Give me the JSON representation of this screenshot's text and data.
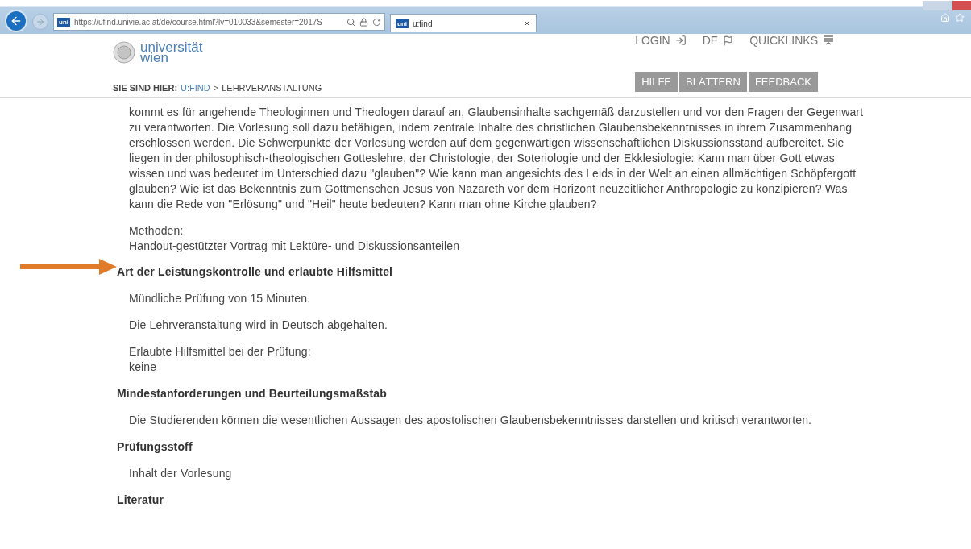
{
  "browser": {
    "url": "https://ufind.univie.ac.at/de/course.html?lv=010033&semester=2017S",
    "tab_title": "u:find",
    "address_badge": "uni",
    "tab_badge": "uni"
  },
  "header": {
    "logo_lines": [
      "universität",
      "wien"
    ],
    "nav": [
      {
        "kind": "login",
        "label": "LOGIN"
      },
      {
        "kind": "language",
        "label": "DE"
      },
      {
        "kind": "menu",
        "label": "QUICKLINKS"
      }
    ],
    "breadcrumb": {
      "label": "SIE SIND HIER:",
      "link": "U:FIND",
      "separator": ">",
      "current": "LEHRVERANSTALTUNG"
    },
    "buttons": [
      "HILFE",
      "BLÄTTERN",
      "FEEDBACK"
    ]
  },
  "content": {
    "intro": "kommt es für angehende Theologinnen und Theologen darauf an, Glaubensinhalte sachgemäß darzustellen und vor den Fragen der Gegenwart zu verantworten. Die Vorlesung soll dazu befähigen, indem zentrale Inhalte des christlichen Glaubensbekenntnisses in ihrem Zusammenhang erschlossen werden. Die Schwerpunkte der Vorlesung werden auf dem gegenwärtigen wissenschaftlichen Diskussionsstand aufbereitet. Sie liegen in der philosophisch-theologischen Gotteslehre, der Christologie, der Soteriologie und der Ekklesiologie: Kann man über Gott etwas wissen und was bedeutet im Unterschied dazu \"glauben\"? Wie kann man angesichts des Leids in der Welt an einen allmächtigen Schöpfergott glauben? Wie ist das Bekenntnis zum Gottmenschen Jesus von Nazareth vor dem Horizont neuzeitlicher Anthropologie zu konzipieren? Was kann die Rede von \"Erlösung\" und \"Heil\" heute bedeuten? Kann man ohne Kirche glauben?",
    "methods": [
      "Methoden:",
      "Handout-gestützter Vortrag mit Lektüre- und Diskussionsanteilen"
    ],
    "sections": [
      {
        "heading": "Art der Leistungskontrolle und erlaubte Hilfsmittel",
        "marked": true,
        "paragraphs": [
          [
            "Mündliche Prüfung von 15 Minuten."
          ],
          [
            "Die Lehrveranstaltung wird in Deutsch abgehalten."
          ],
          [
            "Erlaubte Hilfsmittel bei der Prüfung:",
            "keine"
          ]
        ]
      },
      {
        "heading": "Mindestanforderungen und Beurteilungsmaßstab",
        "marked": false,
        "paragraphs": [
          [
            "Die Studierenden können die wesentlichen Aussagen des apostolischen Glaubensbekenntnisses darstellen und kritisch verantworten."
          ]
        ]
      },
      {
        "heading": "Prüfungsstoff",
        "marked": false,
        "paragraphs": [
          [
            "Inhalt der Vorlesung"
          ]
        ]
      },
      {
        "heading": "Literatur",
        "marked": false
      }
    ]
  }
}
